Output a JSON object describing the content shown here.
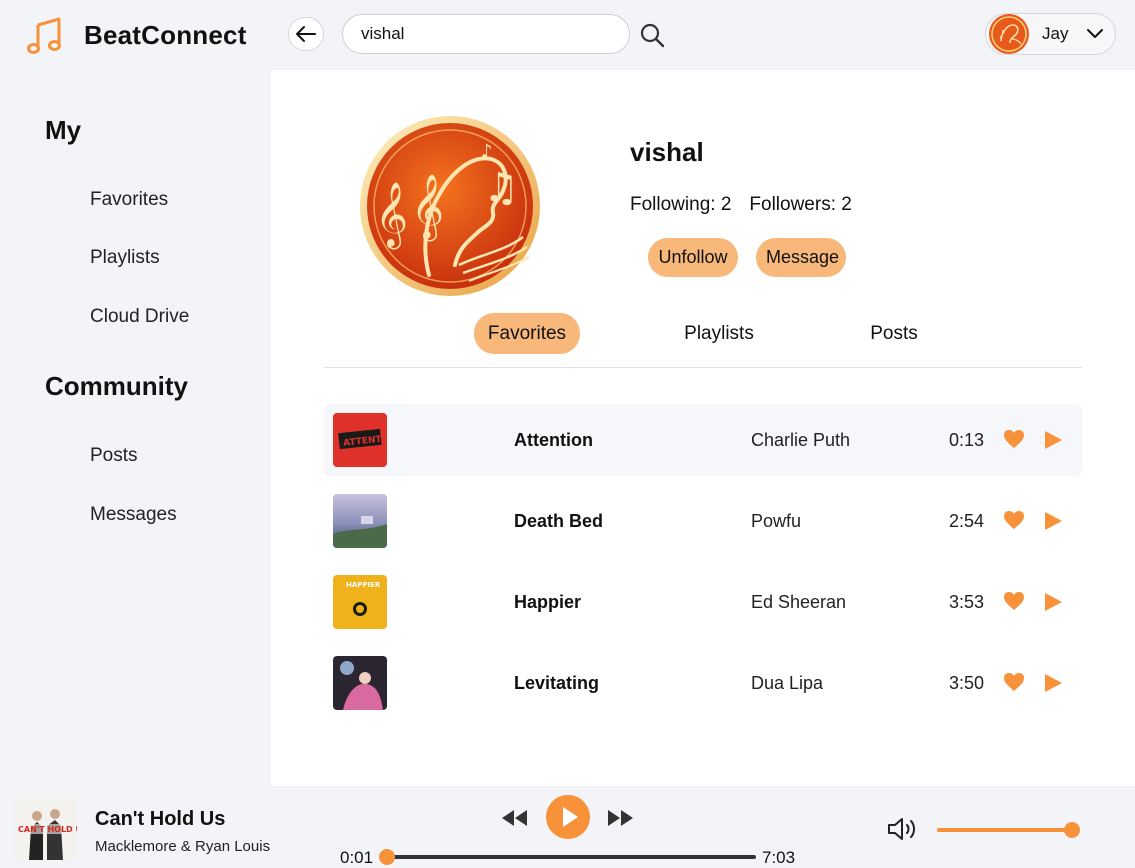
{
  "brand": {
    "name": "BeatConnect",
    "accent": "#f7913a",
    "accent_soft": "#f7b87a"
  },
  "search": {
    "value": "vishal",
    "icon": "search-icon"
  },
  "user": {
    "name": "Jay"
  },
  "sidebar": {
    "my_heading": "My",
    "my_items": [
      {
        "label": "Favorites"
      },
      {
        "label": "Playlists"
      },
      {
        "label": "Cloud Drive"
      }
    ],
    "community_heading": "Community",
    "community_items": [
      {
        "label": "Posts"
      },
      {
        "label": "Messages"
      }
    ]
  },
  "profile": {
    "name": "vishal",
    "following": "Following: 2",
    "followers": "Followers: 2",
    "unfollow_label": "Unfollow",
    "message_label": "Message"
  },
  "tabs": [
    {
      "label": "Favorites",
      "active": true
    },
    {
      "label": "Playlists",
      "active": false
    },
    {
      "label": "Posts",
      "active": false
    }
  ],
  "songs": [
    {
      "title": "Attention",
      "artist": "Charlie Puth",
      "duration": "0:13",
      "cover_color": "#e0312b"
    },
    {
      "title": "Death Bed",
      "artist": "Powfu",
      "duration": "2:54",
      "cover_color": "#8b8fb8"
    },
    {
      "title": "Happier",
      "artist": "Ed Sheeran",
      "duration": "3:53",
      "cover_color": "#f0b21a"
    },
    {
      "title": "Levitating",
      "artist": "Dua Lipa",
      "duration": "3:50",
      "cover_color": "#2a2530"
    }
  ],
  "now_playing": {
    "title": "Can't Hold Us",
    "artist": "Macklemore & Ryan Louis",
    "current_time": "0:01",
    "total_time": "7:03",
    "progress": 0.002,
    "volume": 1.0
  }
}
